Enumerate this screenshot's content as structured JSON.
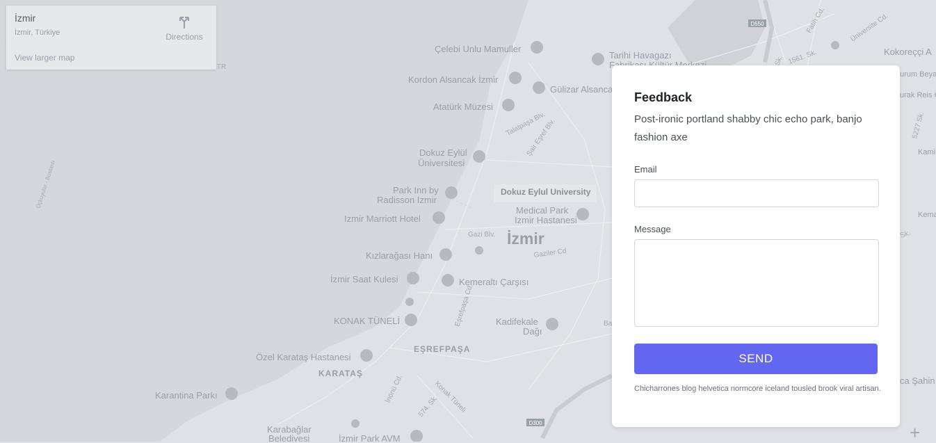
{
  "map": {
    "place_name": "İzmir",
    "address": "İzmir, Türkiye",
    "directions_label": "Directions",
    "view_larger_label": "View larger map",
    "city_label": "İzmir",
    "university_label": "Dokuz Eylul University",
    "poi": [
      "Çelebi Unlu Mamuller",
      "Tarihi Havagazı",
      "Fabrikası Kültür Merkezi",
      "Kordon Alsancak İzmir",
      "Gülizar Alsanca",
      "Atatürk Müzesi",
      "Dokuz Eylül",
      "Üniversitesi",
      "Park Inn by",
      "Radisson Izmir",
      "Medical Park",
      "Izmir Hastanesi",
      "Izmir Marriott Hotel",
      "Kızlarağası Hanı",
      "İzmir Saat Kulesi",
      "Kemeraltı Çarşısı",
      "KONAK TÜNELİ",
      "Kadifekale",
      "Dağı",
      "EŞREFPAŞA",
      "Özel Karataş Hastanesi",
      "KARATAŞ",
      "Karantina Parkı",
      "Karabağlar",
      "Belediyesi",
      "İzmir Park AVM",
      "Kokoreççi A",
      "ca Şahin",
      "urum Beyaz",
      "urak Reis C",
      "Kami",
      "Kema"
    ],
    "streets": [
      "Talatpaşa Blv.",
      "Şair Eşref Blv.",
      "Gazi Blv.",
      "Gaziler Cd",
      "Eşrefpaşa Cd.",
      "İnönü Cd.",
      "Konak Tüneli",
      "574. Sk.",
      "Üçkuyular - Bostanlı",
      "1561. Sk.",
      "Fatih Cd.",
      "Üniversite Cd.",
      "5227 Sk.",
      "Sk.",
      "Ba",
      "zmir, TR"
    ],
    "road_badges": [
      "D550",
      "D300"
    ],
    "zoom_in": "+"
  },
  "feedback": {
    "title": "Feedback",
    "description": "Post-ironic portland shabby chic echo park, banjo fashion axe",
    "email_label": "Email",
    "email_value": "",
    "message_label": "Message",
    "message_value": "",
    "send_label": "SEND",
    "footnote": "Chicharrones blog helvetica normcore iceland tousled brook viral artisan."
  },
  "colors": {
    "accent": "#6366f1",
    "map_bg": "#dfe1e6",
    "map_label": "#9a9ea5"
  }
}
